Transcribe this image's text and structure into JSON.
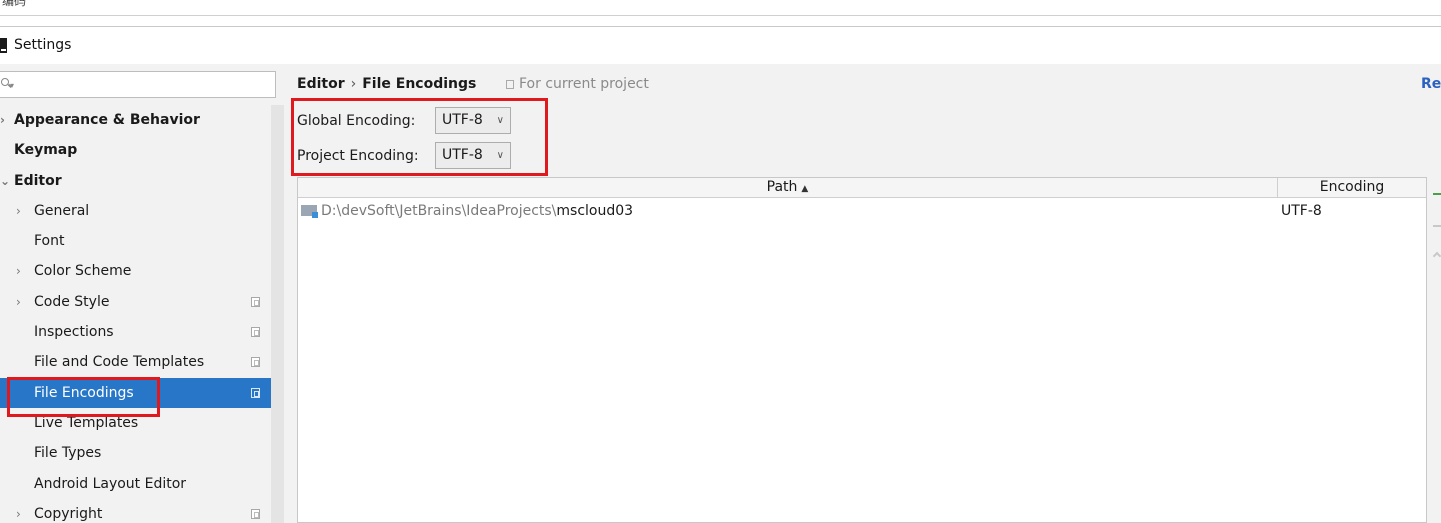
{
  "top_strip": {
    "text": "编码"
  },
  "window": {
    "title": "Settings"
  },
  "search": {
    "value": "",
    "placeholder": ""
  },
  "sidebar": {
    "items": [
      {
        "label": "Appearance & Behavior",
        "bold": true,
        "arrow": "›",
        "level": 0
      },
      {
        "label": "Keymap",
        "bold": true,
        "arrow": "",
        "level": 0
      },
      {
        "label": "Editor",
        "bold": true,
        "arrow": "⌄",
        "level": 0
      },
      {
        "label": "General",
        "bold": false,
        "arrow": "›",
        "level": 1
      },
      {
        "label": "Font",
        "bold": false,
        "arrow": "",
        "level": 1
      },
      {
        "label": "Color Scheme",
        "bold": false,
        "arrow": "›",
        "level": 1
      },
      {
        "label": "Code Style",
        "bold": false,
        "arrow": "›",
        "level": 1,
        "project_icon": true
      },
      {
        "label": "Inspections",
        "bold": false,
        "arrow": "",
        "level": 1,
        "project_icon": true
      },
      {
        "label": "File and Code Templates",
        "bold": false,
        "arrow": "",
        "level": 1,
        "project_icon": true
      },
      {
        "label": "File Encodings",
        "bold": false,
        "arrow": "",
        "level": 1,
        "project_icon": true,
        "selected": true
      },
      {
        "label": "Live Templates",
        "bold": false,
        "arrow": "",
        "level": 1
      },
      {
        "label": "File Types",
        "bold": false,
        "arrow": "",
        "level": 1
      },
      {
        "label": "Android Layout Editor",
        "bold": false,
        "arrow": "",
        "level": 1
      },
      {
        "label": "Copyright",
        "bold": false,
        "arrow": "›",
        "level": 1,
        "project_icon": true
      }
    ]
  },
  "breadcrumb": {
    "parent": "Editor",
    "separator": "›",
    "current": "File Encodings"
  },
  "scope_hint": "For current project",
  "reset_label": "Re",
  "encoding": {
    "global_label": "Global Encoding:",
    "global_value": "UTF-8",
    "project_label": "Project Encoding:",
    "project_value": "UTF-8"
  },
  "table": {
    "headers": {
      "path": "Path",
      "sort": "▲",
      "encoding": "Encoding"
    },
    "rows": [
      {
        "path_prefix": "D:\\devSoft\\JetBrains\\IdeaProjects\\",
        "path_name": "mscloud03",
        "encoding": "UTF-8"
      }
    ]
  },
  "colors": {
    "selection": "#2776c8",
    "highlight_box": "#e0191f",
    "link": "#2a62c0"
  }
}
